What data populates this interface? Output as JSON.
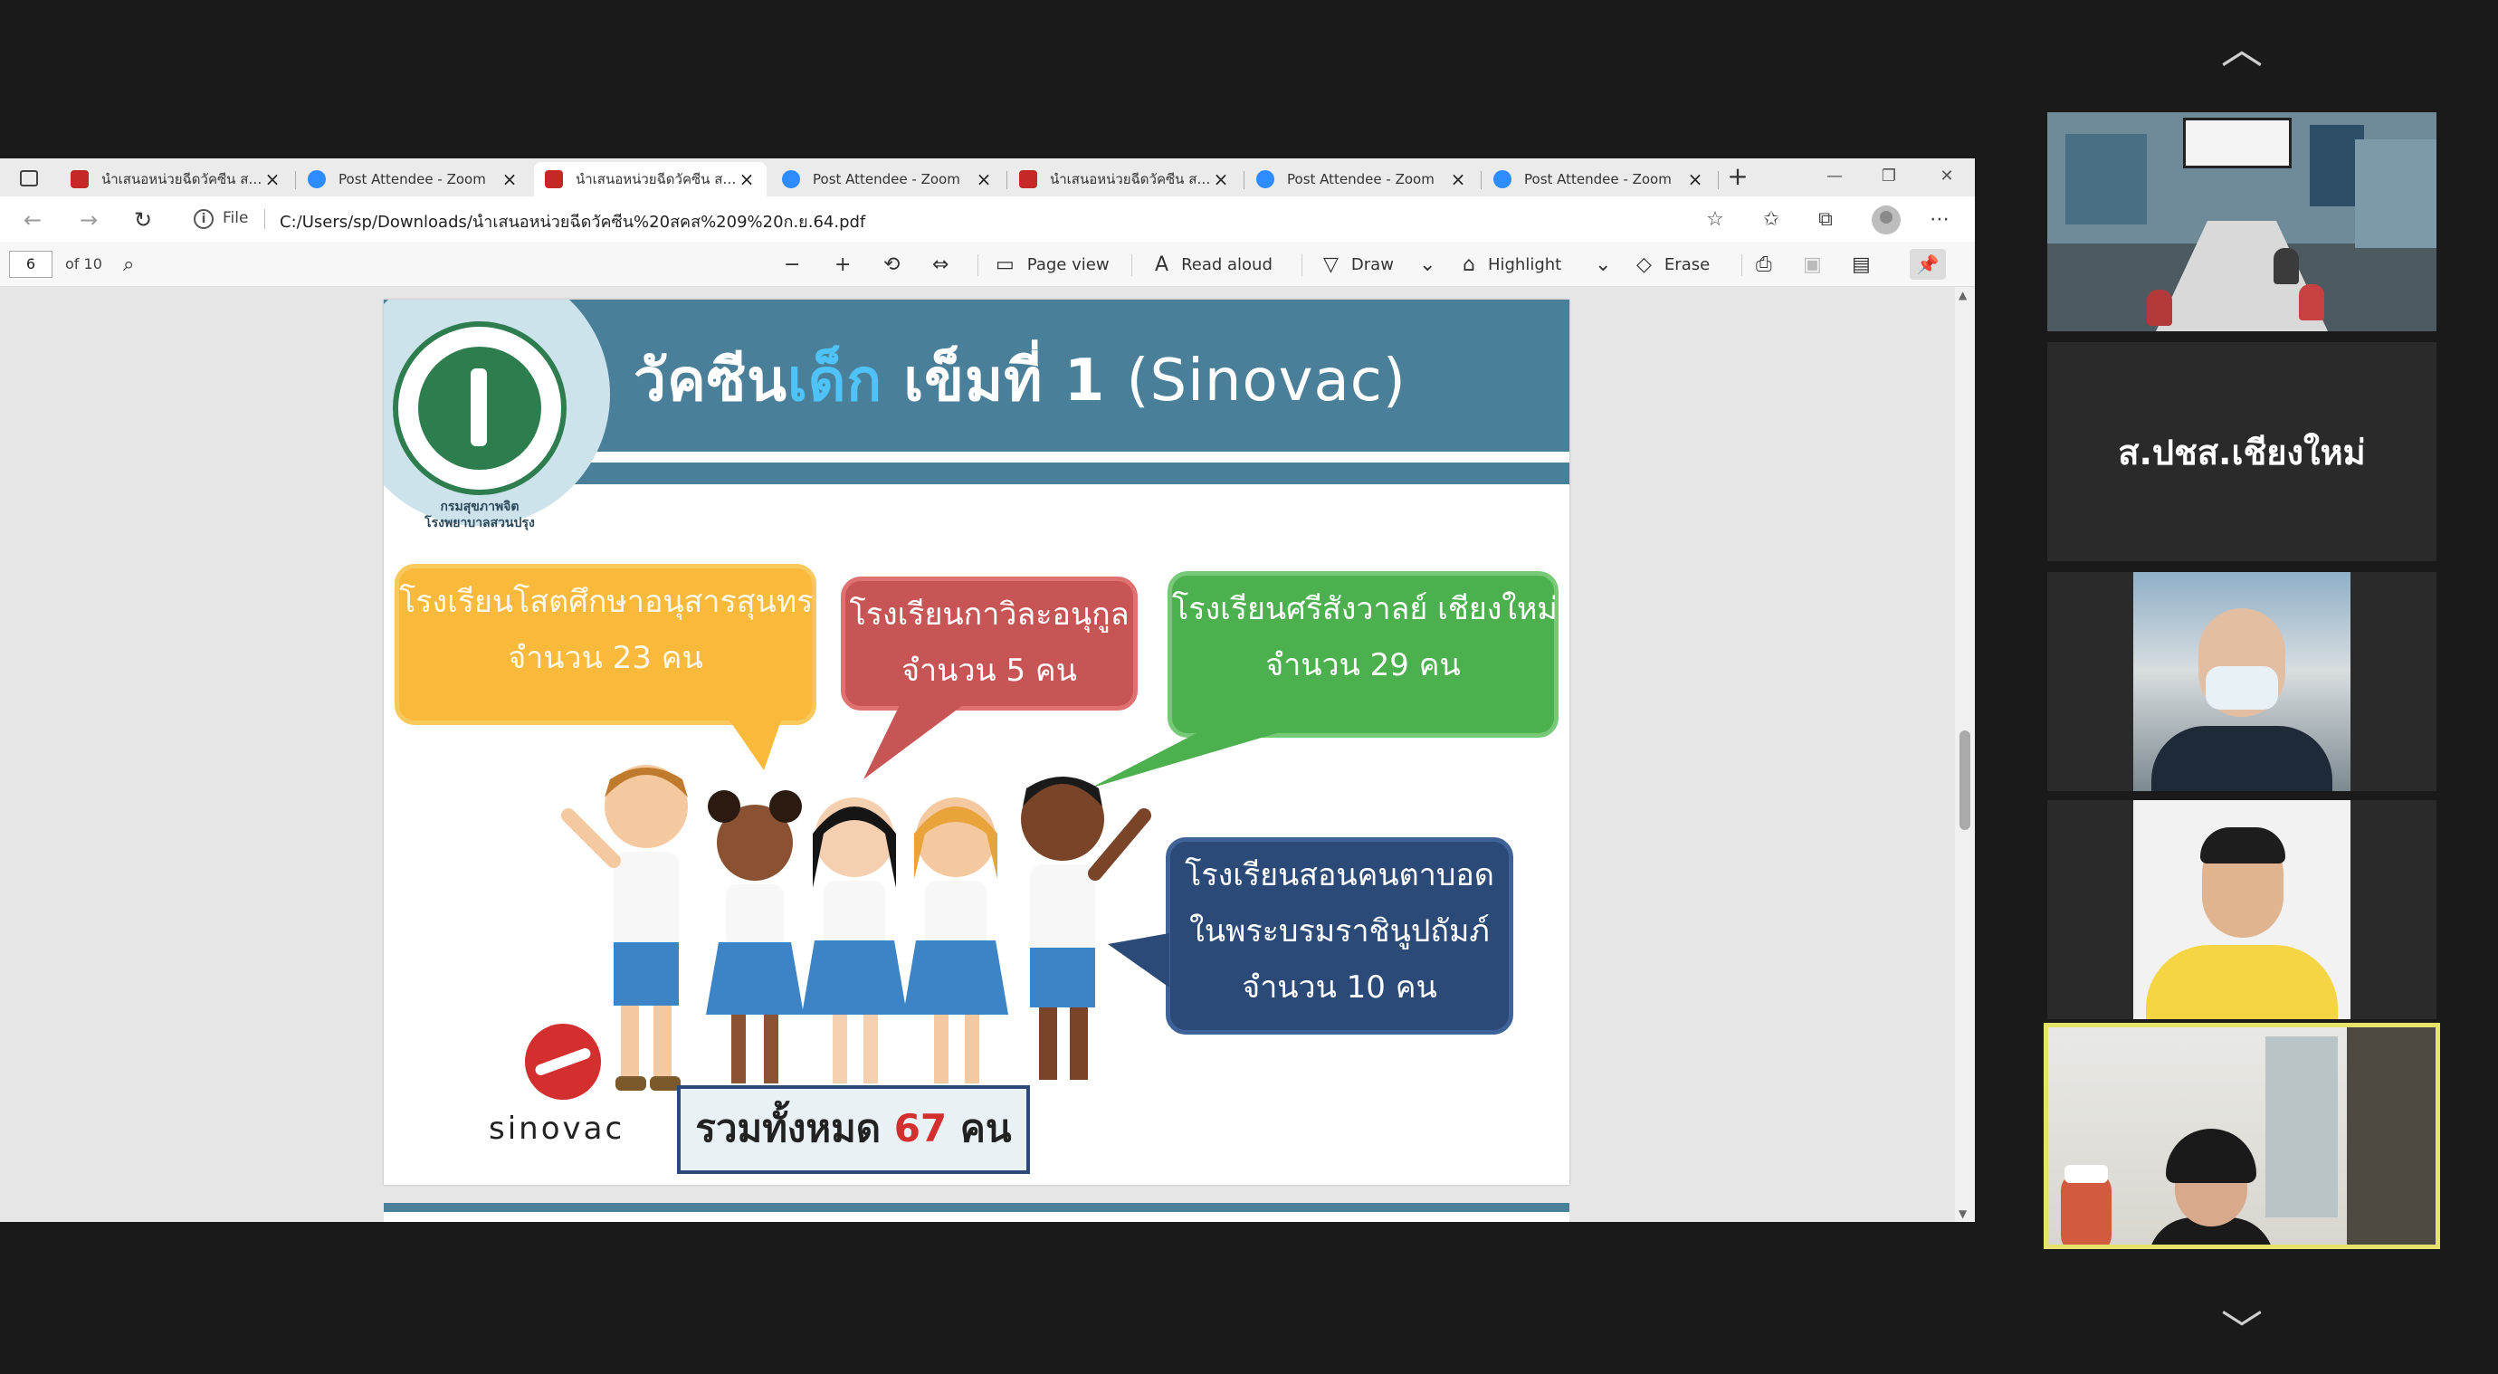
{
  "browser": {
    "tabs": [
      {
        "label": "นำเสนอหน่วยฉีดวัคซีน สคส",
        "type": "pdf",
        "active": false
      },
      {
        "label": "Post Attendee - Zoom",
        "type": "zoom",
        "active": false
      },
      {
        "label": "นำเสนอหน่วยฉีดวัคซีน สคส",
        "type": "pdf",
        "active": true
      },
      {
        "label": "Post Attendee - Zoom",
        "type": "zoom",
        "active": false
      },
      {
        "label": "นำเสนอหน่วยฉีดวัคซีน สคส",
        "type": "pdf",
        "active": false
      },
      {
        "label": "Post Attendee - Zoom",
        "type": "zoom",
        "active": false
      },
      {
        "label": "Post Attendee - Zoom",
        "type": "zoom",
        "active": false
      }
    ],
    "file_label": "File",
    "url": "C:/Users/sp/Downloads/นำเสนอหน่วยฉีดวัคซีน%20สคส%209%20ก.ย.64.pdf"
  },
  "pdf_toolbar": {
    "page_number": "6",
    "page_of": "of 10",
    "page_view": "Page view",
    "read_aloud": "Read aloud",
    "draw": "Draw",
    "highlight": "Highlight",
    "erase": "Erase"
  },
  "slide": {
    "seal_caption_1": "กรมสุขภาพจิต",
    "seal_caption_2": "โรงพยาบาลสวนปรุง",
    "title_part1": "วัคซีน",
    "title_part2": "เด็ก",
    "title_part3": " เข็มที่ 1 ",
    "title_part4": "(Sinovac)",
    "bubbles": {
      "yellow_line1": "โรงเรียนโสตศึกษาอนุสารสุนทร",
      "yellow_line2": "จำนวน 23 คน",
      "red_line1": "โรงเรียนกาวิละอนุกูล",
      "red_line2": "จำนวน 5 คน",
      "green_line1": "โรงเรียนศรีสังวาลย์ เชียงใหม่",
      "green_line2": "จำนวน 29 คน",
      "blue_line1": "โรงเรียนสอนคนตาบอด",
      "blue_line2": "ในพระบรมราชินูปถัมภ์",
      "blue_line3": "จำนวน 10 คน"
    },
    "sinovac_text": "sinovac",
    "total_prefix": "รวมทั้งหมด ",
    "total_number": "67",
    "total_suffix": " คน"
  },
  "zoom": {
    "participant_name": "ส.ปชส.เชียงใหม่"
  },
  "colors": {
    "header_blue": "#4a7f99",
    "bubble_yellow": "#f9b93a",
    "bubble_red": "#c85555",
    "bubble_green": "#4db04f",
    "bubble_blue": "#2b4a78",
    "active_speaker_border": "#e6e36a"
  }
}
